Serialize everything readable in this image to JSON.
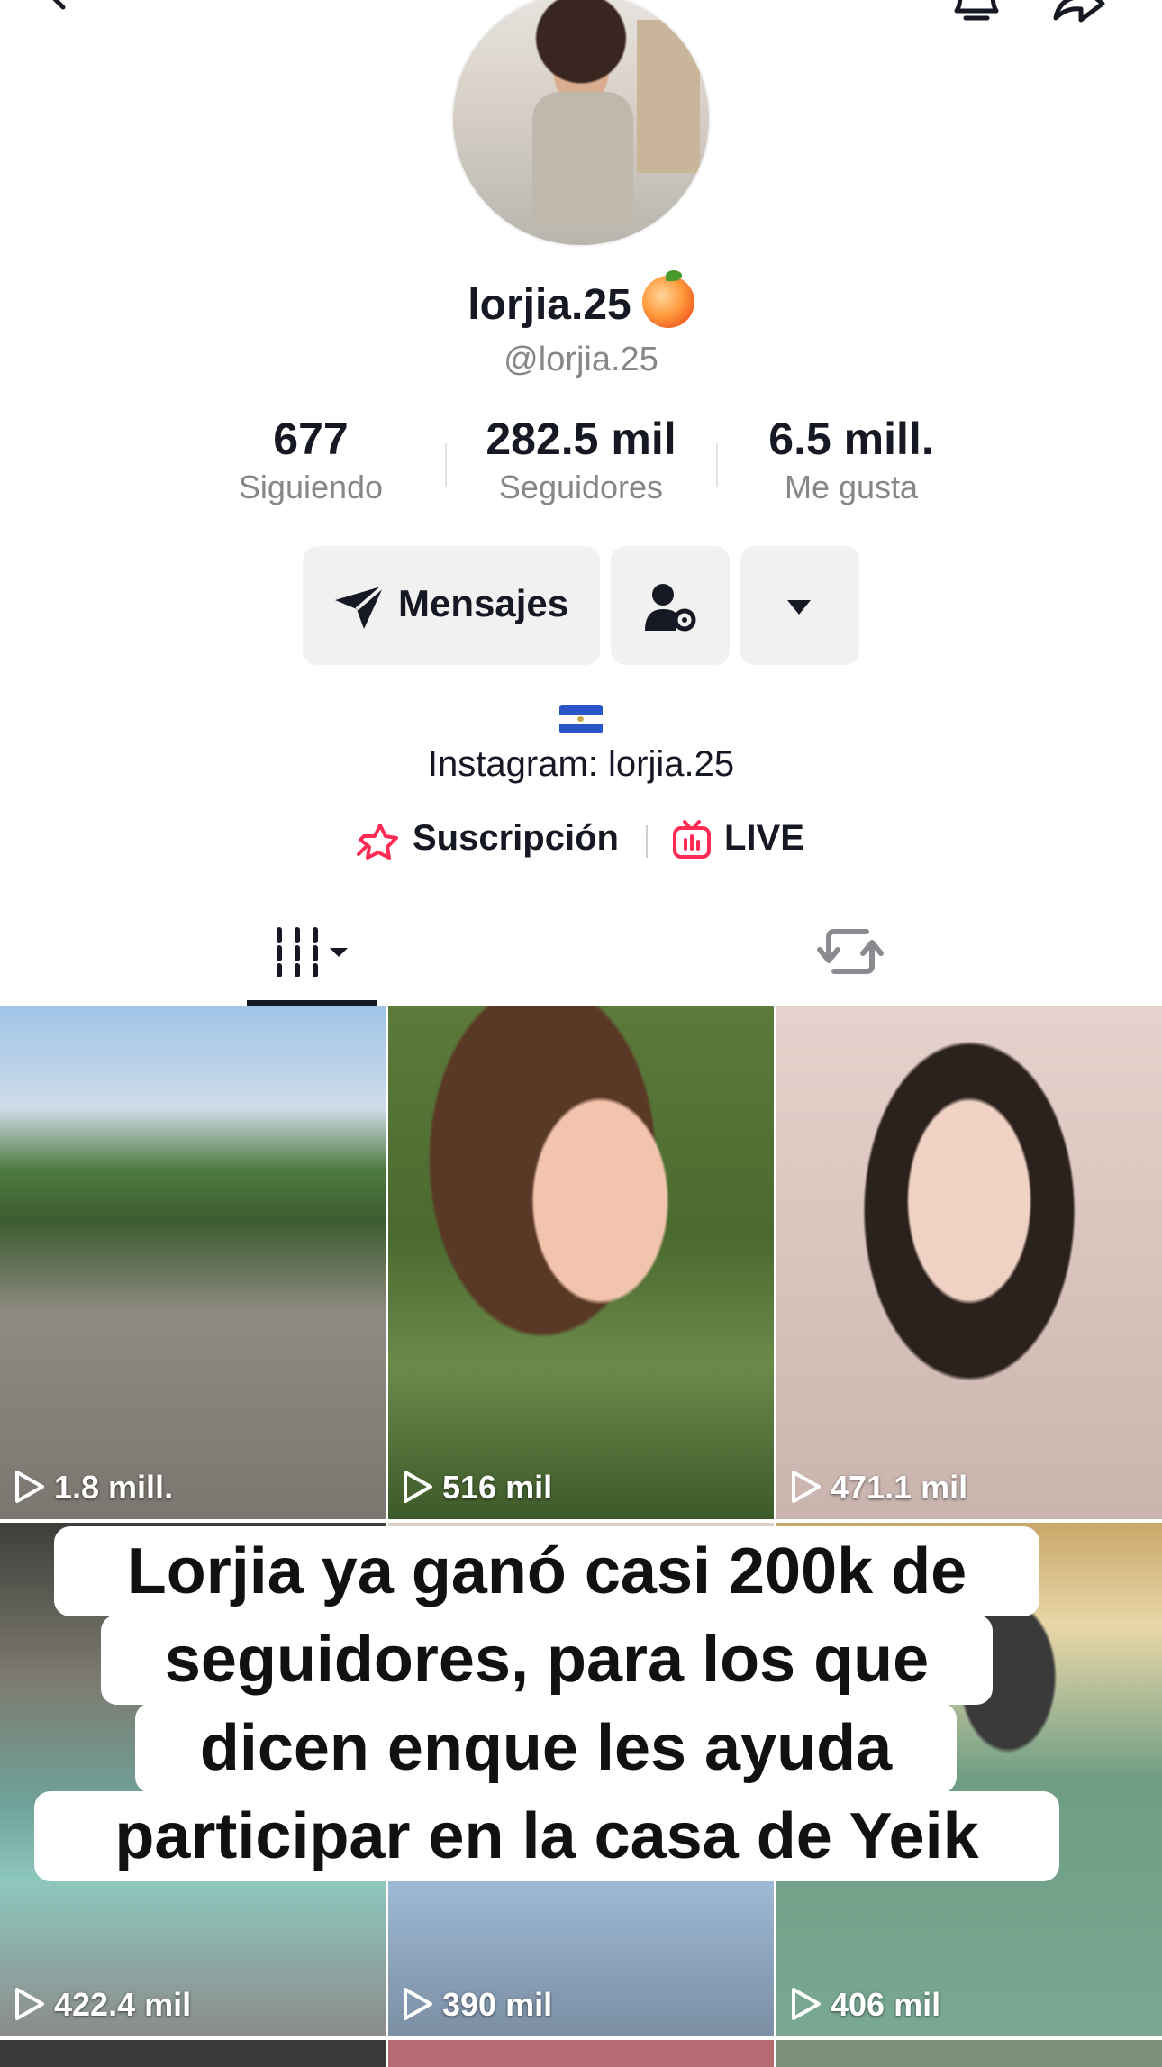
{
  "header": {
    "back_icon": "chevron-left-icon",
    "notifications_icon": "bell-icon",
    "share_icon": "share-arrow-icon"
  },
  "profile": {
    "display_name": "lorjia.25",
    "name_emoji": "peach-emoji",
    "username": "@lorjia.25",
    "bio_flag": "el-salvador-flag",
    "bio_text": "Instagram: lorjia.25"
  },
  "stats": [
    {
      "value": "677",
      "label": "Siguiendo"
    },
    {
      "value": "282.5 mil",
      "label": "Seguidores"
    },
    {
      "value": "6.5 mill.",
      "label": "Me gusta"
    }
  ],
  "actions": {
    "messages_label": "Mensajes",
    "messages_icon": "send-icon",
    "friends_icon": "user-settings-icon",
    "more_icon": "caret-down-icon"
  },
  "links": {
    "subscription_label": "Suscripción",
    "subscription_icon": "star-badge-icon",
    "live_label": "LIVE",
    "live_icon": "live-tv-icon",
    "accent_color": "#fe2c55"
  },
  "tabs": [
    {
      "name": "videos",
      "icon": "grid-bars-icon",
      "active": true
    },
    {
      "name": "reposts",
      "icon": "repost-icon",
      "active": false
    }
  ],
  "videos": [
    {
      "views": "1.8 mill."
    },
    {
      "views": "516 mil"
    },
    {
      "views": "471.1 mil"
    },
    {
      "views": "422.4 mil"
    },
    {
      "views": "390 mil"
    },
    {
      "views": "406 mil"
    }
  ],
  "caption": {
    "lines": [
      "Lorjia ya ganó casi 200k de",
      "seguidores, para los que",
      "dicen enque les ayuda",
      "participar en la casa de Yeik"
    ]
  }
}
